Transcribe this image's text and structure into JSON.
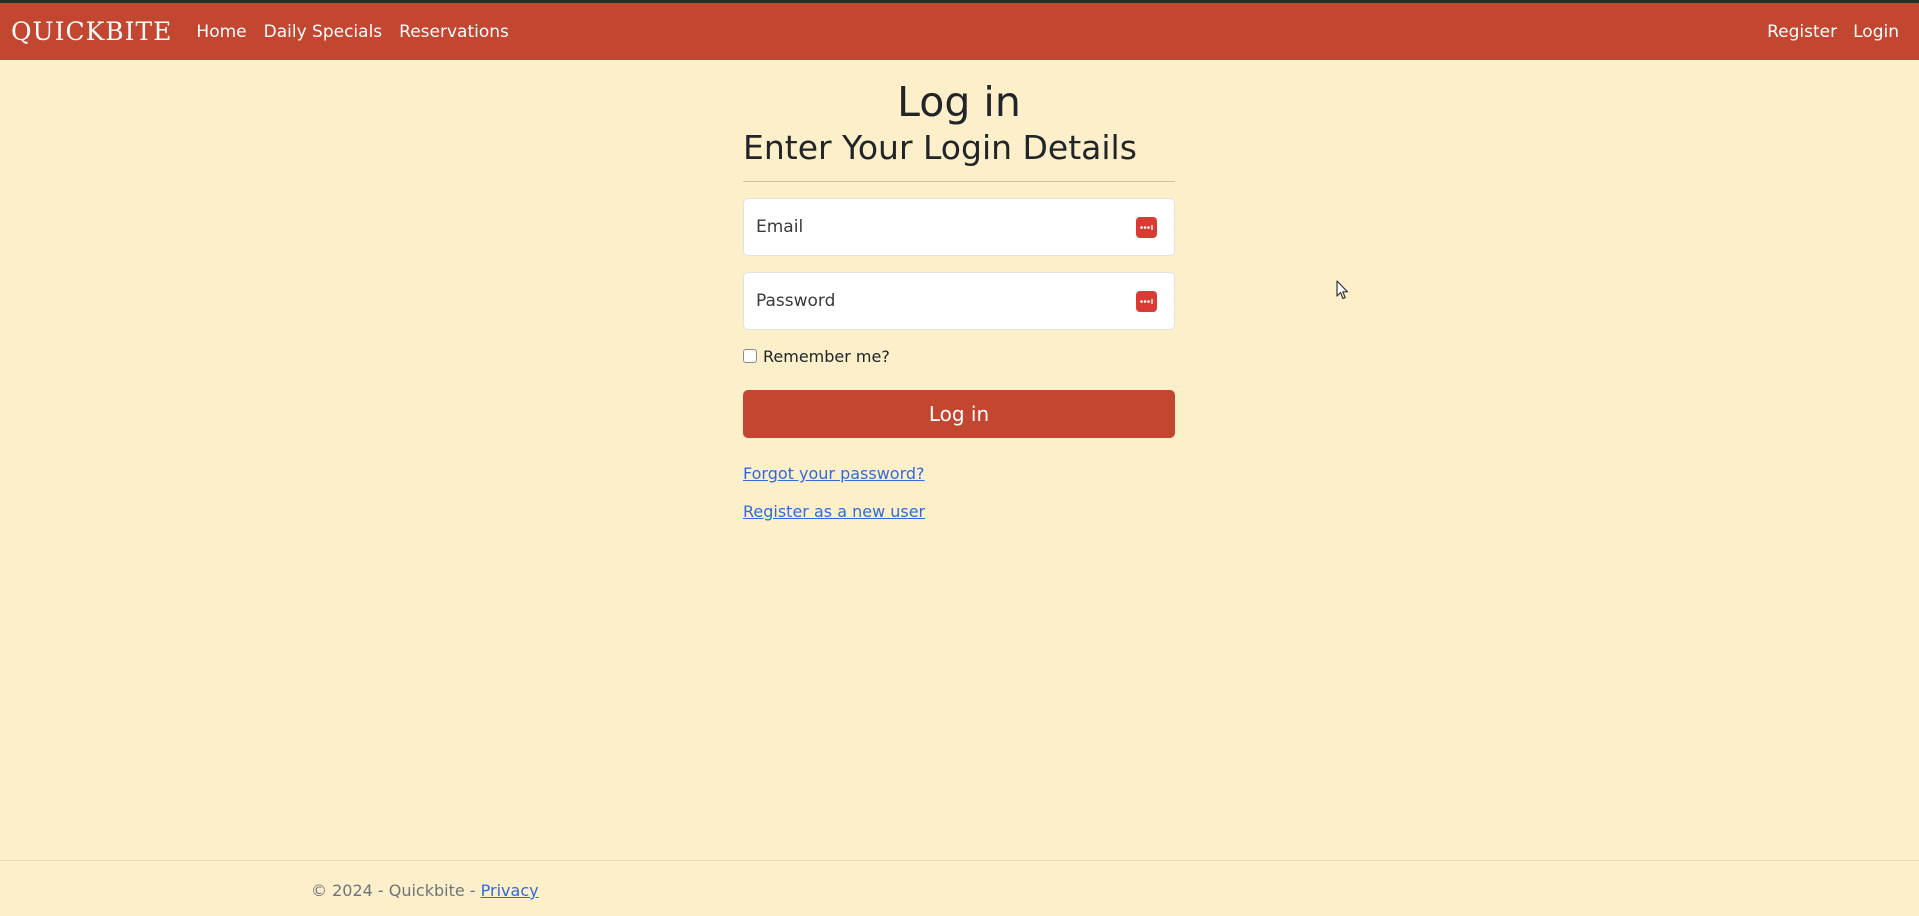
{
  "navbar": {
    "brand": "QUICKBITE",
    "links": [
      "Home",
      "Daily Specials",
      "Reservations"
    ],
    "right_links": [
      "Register",
      "Login"
    ]
  },
  "page": {
    "title": "Log in",
    "subtitle": "Enter Your Login Details"
  },
  "form": {
    "email_placeholder": "Email",
    "password_placeholder": "Password",
    "remember_label": "Remember me?",
    "remember_checked": false,
    "submit_label": "Log in",
    "password_manager_icon": "password-manager-icon"
  },
  "links": {
    "forgot": "Forgot your password?",
    "register": "Register as a new user"
  },
  "footer": {
    "copyright": "© 2024 - Quickbite - ",
    "privacy": "Privacy"
  },
  "colors": {
    "accent": "#c24630",
    "background": "#fdefc9",
    "link": "#2f6adf"
  }
}
